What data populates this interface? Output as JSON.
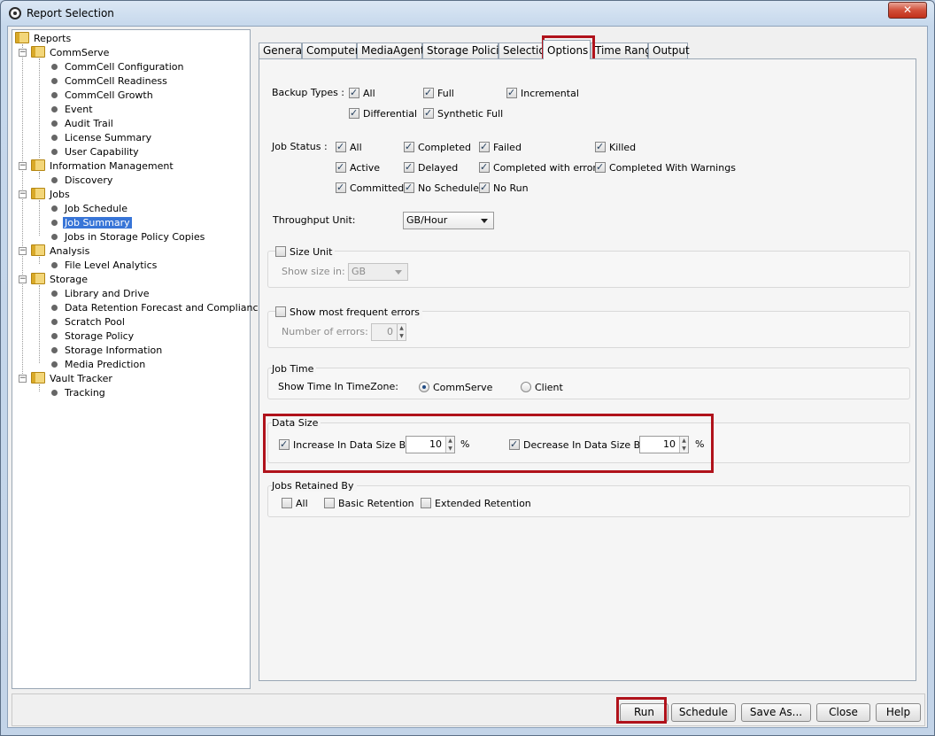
{
  "window": {
    "title": "Report Selection",
    "close_glyph": "✕"
  },
  "tree": {
    "root": "Reports",
    "rows": [
      {
        "label": "CommServe"
      },
      {
        "label": "CommCell Configuration"
      },
      {
        "label": "CommCell Readiness"
      },
      {
        "label": "CommCell Growth"
      },
      {
        "label": "Event"
      },
      {
        "label": "Audit Trail"
      },
      {
        "label": "License Summary"
      },
      {
        "label": "User Capability"
      },
      {
        "label": "Information Management"
      },
      {
        "label": "Discovery"
      },
      {
        "label": "Jobs"
      },
      {
        "label": "Job Schedule"
      },
      {
        "label": "Job Summary"
      },
      {
        "label": "Jobs in Storage Policy Copies"
      },
      {
        "label": "Analysis"
      },
      {
        "label": "File Level Analytics"
      },
      {
        "label": "Storage"
      },
      {
        "label": "Library and Drive"
      },
      {
        "label": "Data Retention Forecast and Compliance"
      },
      {
        "label": "Scratch Pool"
      },
      {
        "label": "Storage Policy"
      },
      {
        "label": "Storage Information"
      },
      {
        "label": "Media Prediction"
      },
      {
        "label": "Vault Tracker"
      },
      {
        "label": "Tracking"
      }
    ],
    "selected": "Job Summary",
    "expander_glyph": "−"
  },
  "tabs": [
    "General",
    "Computers",
    "MediaAgents",
    "Storage Policies",
    "Selection",
    "Options",
    "Time Range",
    "Output"
  ],
  "active_tab": "Options",
  "options": {
    "backup_types": {
      "label": "Backup Types :",
      "items": [
        {
          "label": "All",
          "checked": true
        },
        {
          "label": "Full",
          "checked": true
        },
        {
          "label": "Incremental",
          "checked": true
        },
        {
          "label": "Differential",
          "checked": true
        },
        {
          "label": "Synthetic Full",
          "checked": true
        }
      ]
    },
    "job_status": {
      "label": "Job Status :",
      "items": [
        {
          "label": "All",
          "checked": true
        },
        {
          "label": "Completed",
          "checked": true
        },
        {
          "label": "Failed",
          "checked": true
        },
        {
          "label": "Killed",
          "checked": true
        },
        {
          "label": "Active",
          "checked": true
        },
        {
          "label": "Delayed",
          "checked": true
        },
        {
          "label": "Completed with errors",
          "checked": true
        },
        {
          "label": "Completed With Warnings",
          "checked": true
        },
        {
          "label": "Committed",
          "checked": true
        },
        {
          "label": "No Schedule",
          "checked": true
        },
        {
          "label": "No Run",
          "checked": true
        }
      ]
    },
    "throughput_unit": {
      "label": "Throughput Unit:",
      "value": "GB/Hour"
    },
    "size_unit": {
      "label": "Size Unit",
      "checked": false,
      "show_size_label": "Show size in:",
      "value": "GB"
    },
    "frequent_errors": {
      "label": "Show most frequent errors",
      "checked": false,
      "count_label": "Number of errors:",
      "count": "0"
    },
    "job_time": {
      "title": "Job Time",
      "label": "Show Time In TimeZone:",
      "options": [
        "CommServe",
        "Client"
      ],
      "selected": "CommServe"
    },
    "data_size": {
      "title": "Data Size",
      "increase_label": "Increase In Data Size By",
      "increase_checked": true,
      "increase_value": "10",
      "decrease_label": "Decrease In Data Size By",
      "decrease_checked": true,
      "decrease_value": "10",
      "percent": "%"
    },
    "jobs_retained": {
      "title": "Jobs Retained By",
      "items": [
        {
          "label": "All",
          "checked": false
        },
        {
          "label": "Basic Retention",
          "checked": false
        },
        {
          "label": "Extended Retention",
          "checked": false
        }
      ]
    },
    "spin_up": "▲",
    "spin_down": "▼"
  },
  "buttons": {
    "run": "Run",
    "schedule": "Schedule",
    "save_as": "Save As...",
    "close": "Close",
    "help": "Help"
  },
  "highlight_color": "#b0121b"
}
